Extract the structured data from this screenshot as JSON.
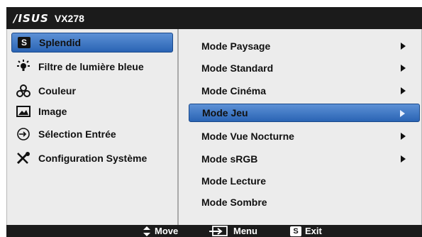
{
  "title": {
    "brand": "/ISUS",
    "model": "VX278"
  },
  "left_menu": [
    {
      "label": "Splendid",
      "icon": "splendid-s-icon",
      "selected": true
    },
    {
      "label": "Filtre de lumière bleue",
      "icon": "bluelight-icon",
      "selected": false
    },
    {
      "label": "Couleur",
      "icon": "color-icon",
      "selected": false
    },
    {
      "label": "Image",
      "icon": "image-icon",
      "selected": false
    },
    {
      "label": "Sélection Entrée",
      "icon": "input-icon",
      "selected": false
    },
    {
      "label": "Configuration Système",
      "icon": "tools-icon",
      "selected": false
    }
  ],
  "right_menu": [
    {
      "label": "Mode Paysage",
      "has_submenu": true,
      "selected": false
    },
    {
      "label": "Mode Standard",
      "has_submenu": true,
      "selected": false
    },
    {
      "label": "Mode Cinéma",
      "has_submenu": true,
      "selected": false
    },
    {
      "label": "Mode Jeu",
      "has_submenu": true,
      "selected": true
    },
    {
      "label": "Mode Vue Nocturne",
      "has_submenu": true,
      "selected": false
    },
    {
      "label": "Mode sRGB",
      "has_submenu": true,
      "selected": false
    },
    {
      "label": "Mode Lecture",
      "has_submenu": false,
      "selected": false
    },
    {
      "label": "Mode Sombre",
      "has_submenu": false,
      "selected": false
    }
  ],
  "footer": {
    "move": "Move",
    "menu": "Menu",
    "exit_badge": "S",
    "exit": "Exit"
  },
  "colors": {
    "highlight": "#3b74c4",
    "panel": "#ececec",
    "bar": "#1b1b1b"
  }
}
